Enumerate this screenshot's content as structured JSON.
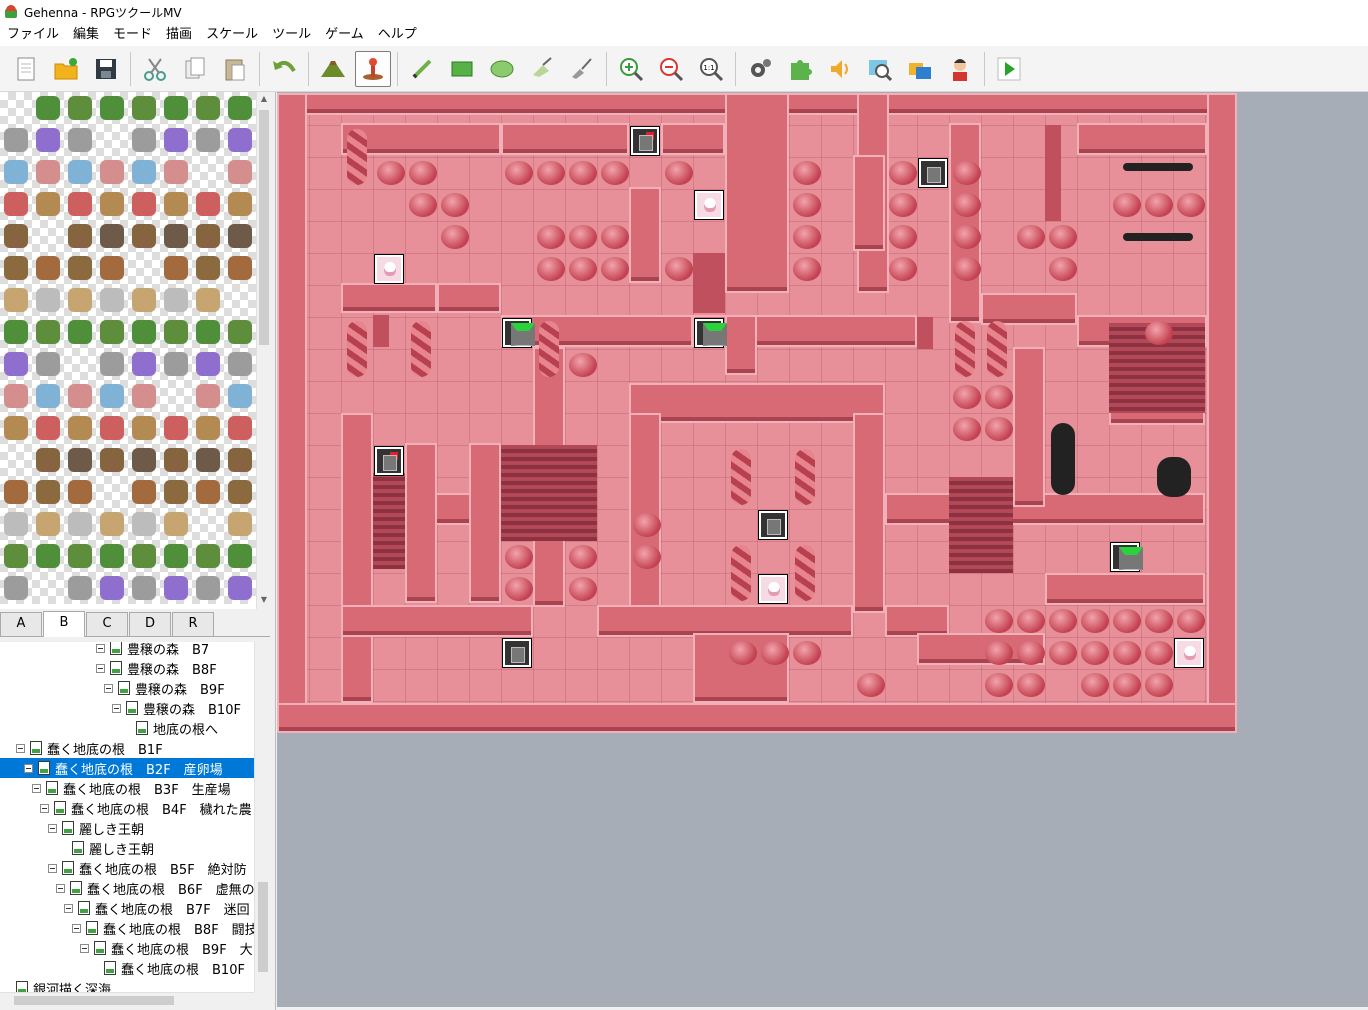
{
  "window": {
    "title": "Gehenna - RPGツクールMV"
  },
  "menu": [
    "ファイル",
    "編集",
    "モード",
    "描画",
    "スケール",
    "ツール",
    "ゲーム",
    "ヘルプ"
  ],
  "toolbar": {
    "groups": [
      [
        "new-project-icon",
        "open-project-icon",
        "save-project-icon"
      ],
      [
        "cut-icon",
        "copy-icon",
        "paste-icon"
      ],
      [
        "undo-icon"
      ],
      [
        "map-mode-icon",
        "event-mode-icon"
      ],
      [
        "pencil-icon",
        "rectangle-icon",
        "ellipse-icon",
        "fill-icon",
        "shadow-pen-icon"
      ],
      [
        "zoom-in-icon",
        "zoom-out-icon",
        "zoom-actual-icon"
      ],
      [
        "database-icon",
        "plugin-manager-icon",
        "sound-test-icon",
        "event-searcher-icon",
        "resource-manager-icon",
        "character-generator-icon"
      ],
      [
        "playtest-icon"
      ]
    ],
    "active": "event-mode-icon"
  },
  "tileset_tabs": [
    "A",
    "B",
    "C",
    "D",
    "R"
  ],
  "tileset_selected_tab": "B",
  "map_tree": [
    {
      "label": "豊穣の森　B7",
      "indent": 96,
      "exp": true
    },
    {
      "label": "豊穣の森　B8F",
      "indent": 96,
      "exp": true
    },
    {
      "label": "豊穣の森　B9F",
      "indent": 104,
      "exp": true
    },
    {
      "label": "豊穣の森　B10F",
      "indent": 112,
      "exp": true
    },
    {
      "label": "地底の根へ",
      "indent": 136,
      "exp": false
    },
    {
      "label": "蠢く地底の根　B1F",
      "indent": 16,
      "exp": true
    },
    {
      "label": "蠢く地底の根　B2F　産卵場",
      "indent": 24,
      "exp": true,
      "selected": true
    },
    {
      "label": "蠢く地底の根　B3F　生産場",
      "indent": 32,
      "exp": true
    },
    {
      "label": "蠢く地底の根　B4F　穢れた農",
      "indent": 40,
      "exp": true
    },
    {
      "label": "麗しき王朝",
      "indent": 48,
      "exp": true
    },
    {
      "label": "麗しき王朝",
      "indent": 72,
      "exp": false
    },
    {
      "label": "蠢く地底の根　B5F　絶対防",
      "indent": 48,
      "exp": true
    },
    {
      "label": "蠢く地底の根　B6F　虚無の",
      "indent": 56,
      "exp": true
    },
    {
      "label": "蠢く地底の根　B7F　迷回",
      "indent": 64,
      "exp": true
    },
    {
      "label": "蠢く地底の根　B8F　闘技",
      "indent": 72,
      "exp": true
    },
    {
      "label": "蠢く地底の根　B9F　大",
      "indent": 80,
      "exp": true
    },
    {
      "label": "蠢く地底の根　B10F",
      "indent": 104,
      "exp": false
    },
    {
      "label": "銀河描く深海",
      "indent": 16,
      "exp": false
    }
  ]
}
